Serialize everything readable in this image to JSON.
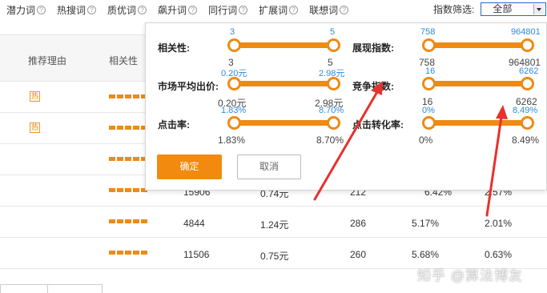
{
  "tabs": [
    {
      "label": "潜力词"
    },
    {
      "label": "热搜词"
    },
    {
      "label": "质优词"
    },
    {
      "label": "飙升词"
    },
    {
      "label": "同行词"
    },
    {
      "label": "扩展词"
    },
    {
      "label": "联想词"
    }
  ],
  "help_glyph": "?",
  "filter": {
    "label": "指数筛选:",
    "selected": "全部"
  },
  "table": {
    "headers": {
      "reason": "推荐理由",
      "relevance": "相关性"
    },
    "hot_badge": "热",
    "rows": [
      {
        "hot": true,
        "show": "",
        "price": "",
        "competition": "",
        "ctr": "",
        "cvr": ""
      },
      {
        "hot": true,
        "show": "",
        "price": "",
        "competition": "",
        "ctr": "",
        "cvr": ""
      },
      {
        "hot": false,
        "show": "",
        "price": "",
        "competition": "",
        "ctr": "",
        "cvr": ""
      },
      {
        "hot": false,
        "show": "15906",
        "price": "0.74元",
        "competition": "212",
        "ctr": "6.42%",
        "cvr": "2.57%"
      },
      {
        "hot": false,
        "show": "4844",
        "price": "1.24元",
        "competition": "286",
        "ctr": "5.17%",
        "cvr": "2.01%"
      },
      {
        "hot": false,
        "show": "11506",
        "price": "0.75元",
        "competition": "260",
        "ctr": "5.68%",
        "cvr": "0.63%"
      }
    ]
  },
  "popup": {
    "filters": [
      {
        "label": "相关性:",
        "min": "3",
        "max": "5",
        "min_value": "3",
        "max_value": "5"
      },
      {
        "label": "展现指数:",
        "min": "758",
        "max": "964801",
        "min_value": "758",
        "max_value": "964801"
      },
      {
        "label": "市场平均出价:",
        "min": "0.20元",
        "max": "2.98元",
        "min_value": "0.20元",
        "max_value": "2.98元"
      },
      {
        "label": "竞争指数:",
        "min": "16",
        "max": "6262",
        "min_value": "16",
        "max_value": "6262"
      },
      {
        "label": "点击率:",
        "min": "1.83%",
        "max": "8.70%",
        "min_value": "1.83%",
        "max_value": "8.70%"
      },
      {
        "label": "点击转化率:",
        "min": "0%",
        "max": "8.49%",
        "min_value": "0%",
        "max_value": "8.49%"
      }
    ],
    "ok_label": "确定",
    "cancel_label": "取消"
  },
  "watermark": "知乎 @算法博友",
  "colors": {
    "accent": "#ef8a13",
    "value_blue": "#2f8ad8",
    "arrow_red": "#e8302c"
  }
}
